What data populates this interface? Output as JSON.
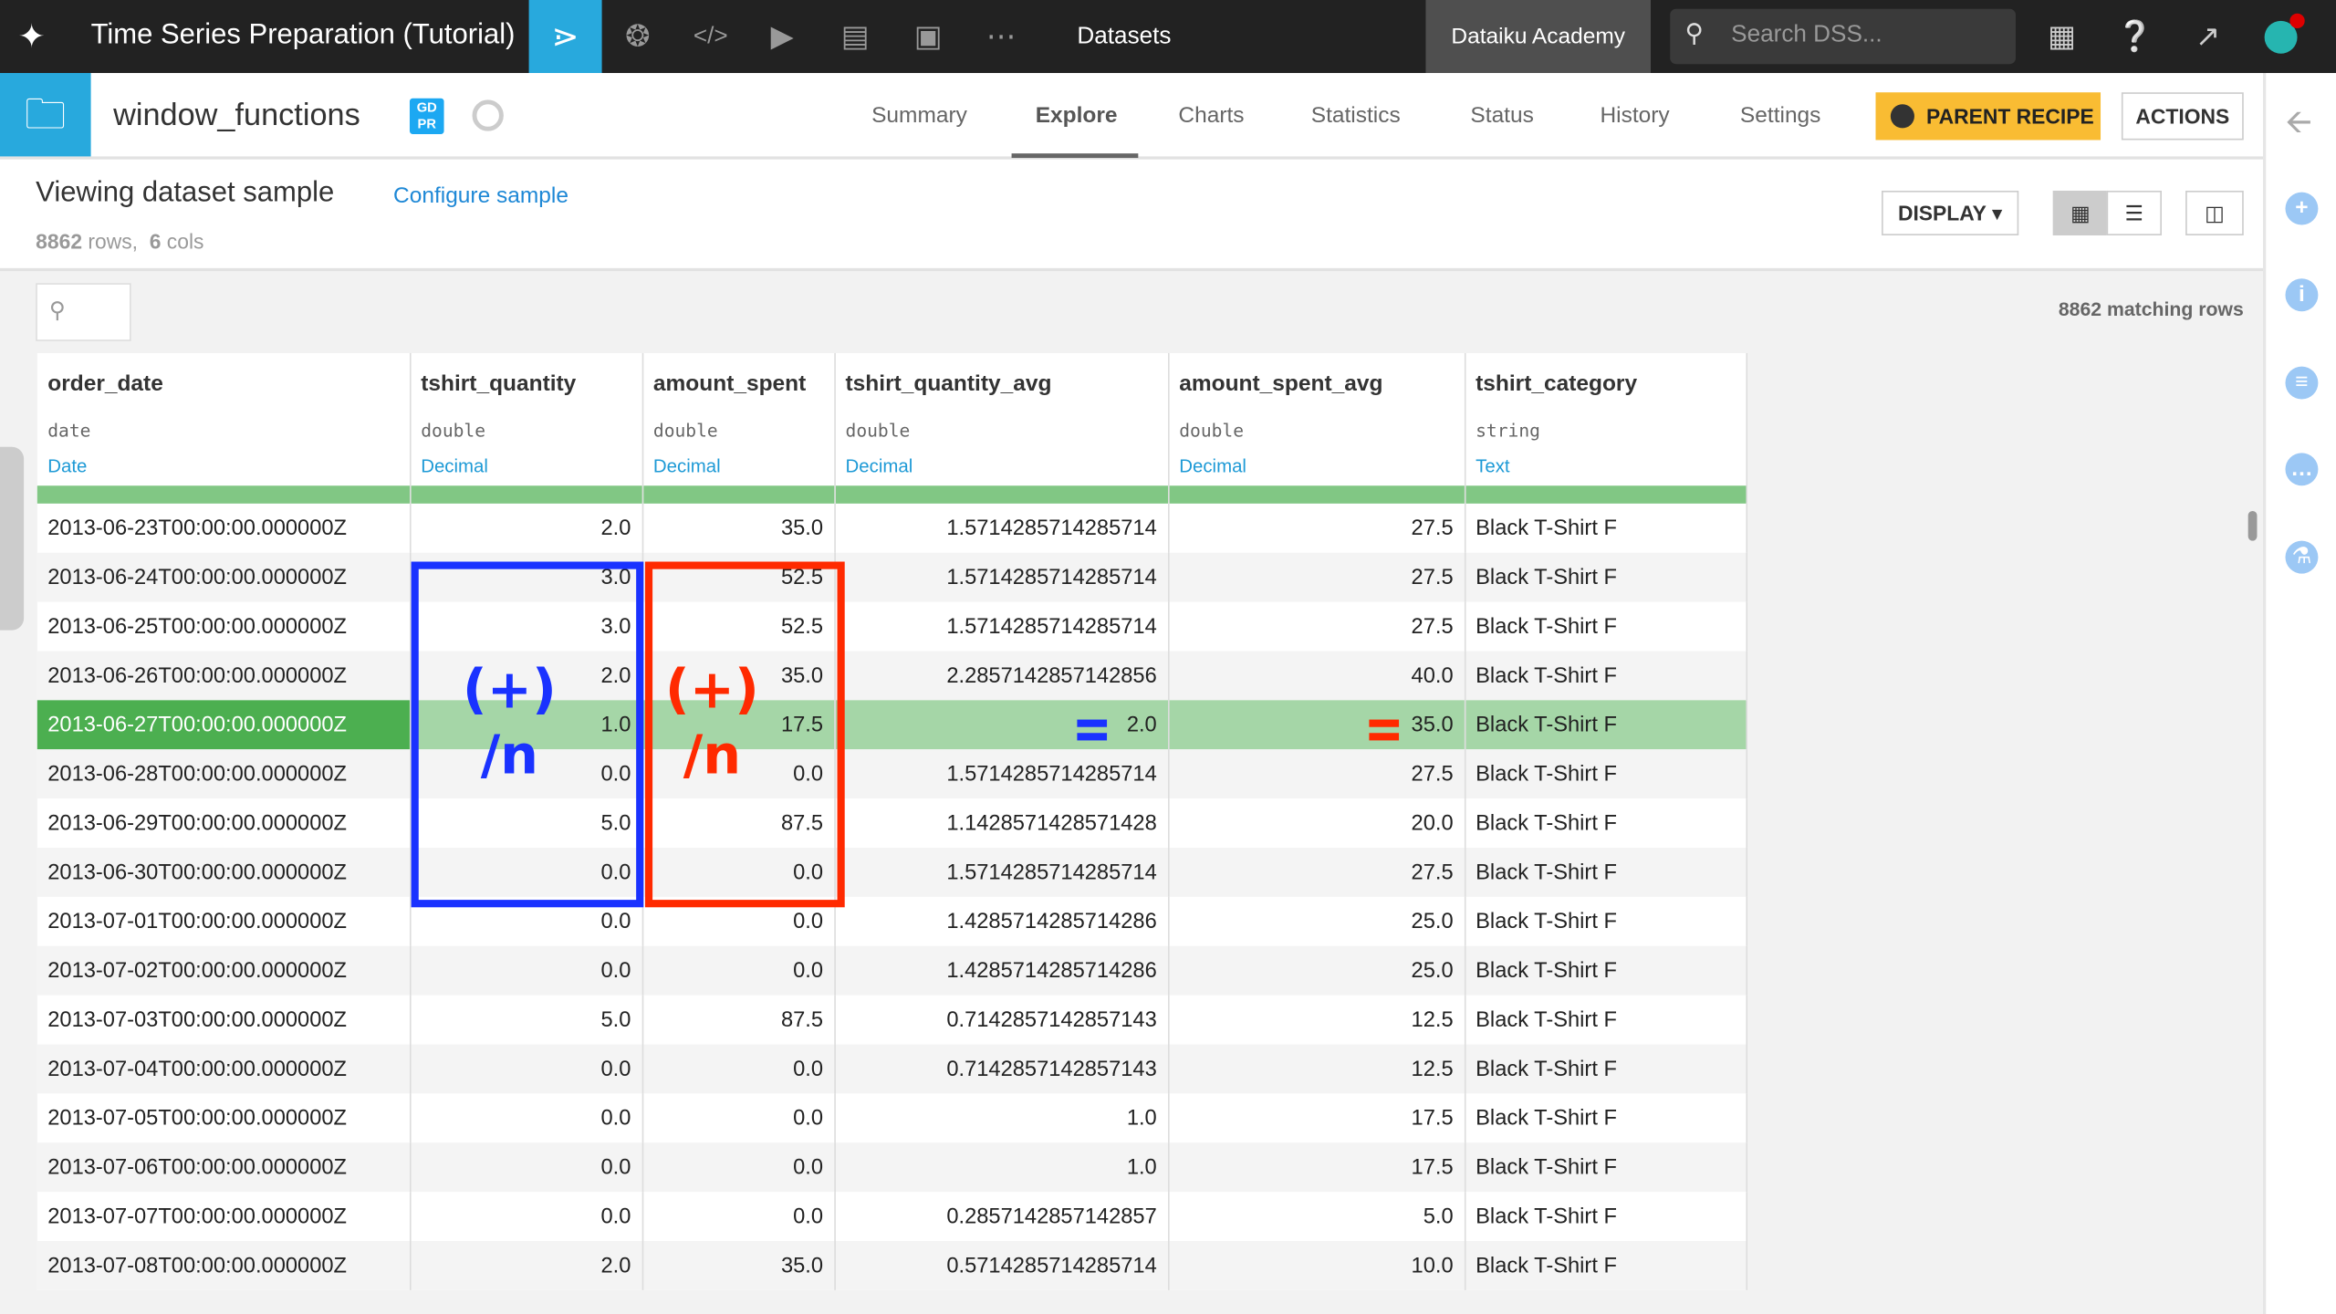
{
  "topbar": {
    "project_title": "Time Series Preparation (Tutorial)",
    "section": "Datasets",
    "academy": "Dataiku Academy",
    "search_placeholder": "Search DSS...",
    "icons": [
      "flow-icon",
      "recipes-icon",
      "code-icon",
      "run-icon",
      "deploy-icon",
      "dashboard-icon",
      "more-icon",
      "apps-grid-icon",
      "help-icon",
      "activity-icon",
      "avatar"
    ]
  },
  "dataset": {
    "name": "window_functions",
    "badge": "GD PR",
    "tabs": [
      "Summary",
      "Explore",
      "Charts",
      "Statistics",
      "Status",
      "History",
      "Settings"
    ],
    "active_tab": "Explore",
    "parent_recipe": "PARENT RECIPE",
    "actions": "ACTIONS"
  },
  "sample": {
    "title": "Viewing dataset sample",
    "configure": "Configure sample",
    "rows_count": "8862",
    "rows_label": "rows,",
    "cols_count": "6",
    "cols_label": "cols",
    "display": "DISPLAY",
    "matching": "8862 matching rows"
  },
  "columns": [
    {
      "name": "order_date",
      "type": "date",
      "meaning": "Date"
    },
    {
      "name": "tshirt_quantity",
      "type": "double",
      "meaning": "Decimal"
    },
    {
      "name": "amount_spent",
      "type": "double",
      "meaning": "Decimal"
    },
    {
      "name": "tshirt_quantity_avg",
      "type": "double",
      "meaning": "Decimal"
    },
    {
      "name": "amount_spent_avg",
      "type": "double",
      "meaning": "Decimal"
    },
    {
      "name": "tshirt_category",
      "type": "string",
      "meaning": "Text"
    }
  ],
  "rows": [
    [
      "2013-06-23T00:00:00.000000Z",
      "2.0",
      "35.0",
      "1.5714285714285714",
      "27.5",
      "Black T-Shirt F"
    ],
    [
      "2013-06-24T00:00:00.000000Z",
      "3.0",
      "52.5",
      "1.5714285714285714",
      "27.5",
      "Black T-Shirt F"
    ],
    [
      "2013-06-25T00:00:00.000000Z",
      "3.0",
      "52.5",
      "1.5714285714285714",
      "27.5",
      "Black T-Shirt F"
    ],
    [
      "2013-06-26T00:00:00.000000Z",
      "2.0",
      "35.0",
      "2.2857142857142856",
      "40.0",
      "Black T-Shirt F"
    ],
    [
      "2013-06-27T00:00:00.000000Z",
      "1.0",
      "17.5",
      "2.0",
      "35.0",
      "Black T-Shirt F"
    ],
    [
      "2013-06-28T00:00:00.000000Z",
      "0.0",
      "0.0",
      "1.5714285714285714",
      "27.5",
      "Black T-Shirt F"
    ],
    [
      "2013-06-29T00:00:00.000000Z",
      "5.0",
      "87.5",
      "1.1428571428571428",
      "20.0",
      "Black T-Shirt F"
    ],
    [
      "2013-06-30T00:00:00.000000Z",
      "0.0",
      "0.0",
      "1.5714285714285714",
      "27.5",
      "Black T-Shirt F"
    ],
    [
      "2013-07-01T00:00:00.000000Z",
      "0.0",
      "0.0",
      "1.4285714285714286",
      "25.0",
      "Black T-Shirt F"
    ],
    [
      "2013-07-02T00:00:00.000000Z",
      "0.0",
      "0.0",
      "1.4285714285714286",
      "25.0",
      "Black T-Shirt F"
    ],
    [
      "2013-07-03T00:00:00.000000Z",
      "5.0",
      "87.5",
      "0.7142857142857143",
      "12.5",
      "Black T-Shirt F"
    ],
    [
      "2013-07-04T00:00:00.000000Z",
      "0.0",
      "0.0",
      "0.7142857142857143",
      "12.5",
      "Black T-Shirt F"
    ],
    [
      "2013-07-05T00:00:00.000000Z",
      "0.0",
      "0.0",
      "1.0",
      "17.5",
      "Black T-Shirt F"
    ],
    [
      "2013-07-06T00:00:00.000000Z",
      "0.0",
      "0.0",
      "1.0",
      "17.5",
      "Black T-Shirt F"
    ],
    [
      "2013-07-07T00:00:00.000000Z",
      "0.0",
      "0.0",
      "0.2857142857142857",
      "5.0",
      "Black T-Shirt F"
    ],
    [
      "2013-07-08T00:00:00.000000Z",
      "2.0",
      "35.0",
      "0.5714285714285714",
      "10.0",
      "Black T-Shirt F"
    ]
  ],
  "highlighted_row": 4,
  "annotations": {
    "sum_label": "(+)",
    "div_label": "/n",
    "equals": "=",
    "blue": "#1a32ff",
    "red": "#ff2a00"
  },
  "colors": {
    "accent": "#28a9dd",
    "parent_recipe": "#f9bc33",
    "valid_bar": "#81c784",
    "highlight": "#4caf50"
  }
}
